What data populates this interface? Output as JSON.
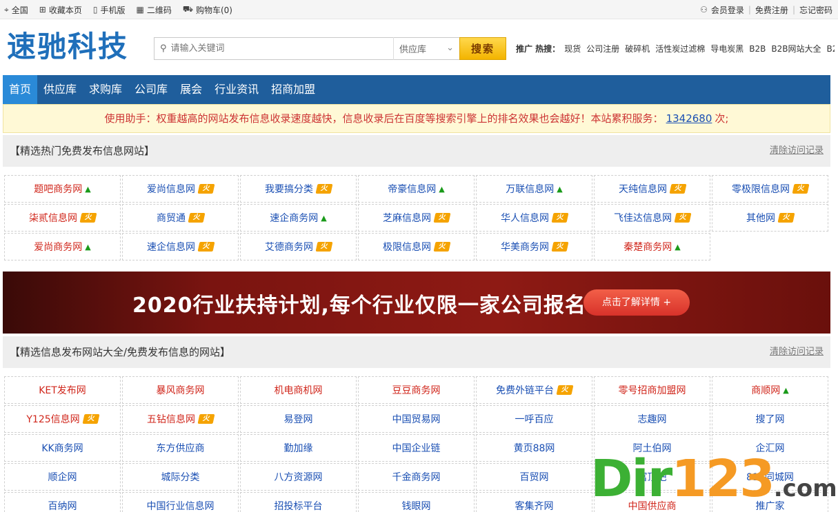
{
  "topbar": {
    "left": [
      {
        "icon": "location-icon",
        "glyph": "⌖",
        "label": "全国"
      },
      {
        "icon": "bookmark-icon",
        "glyph": "⊞",
        "label": "收藏本页"
      },
      {
        "icon": "mobile-icon",
        "glyph": "▯",
        "label": "手机版"
      },
      {
        "icon": "qrcode-icon",
        "glyph": "▦",
        "label": "二维码"
      },
      {
        "icon": "cart-icon",
        "glyph": "⛟",
        "label": "购物车(0)"
      }
    ],
    "login": "会员登录",
    "register": "免费注册",
    "forgot": "忘记密码"
  },
  "logo": "速驰科技",
  "search": {
    "placeholder": "请输入关键词",
    "category": "供应库",
    "button": "搜索"
  },
  "hot": {
    "label": "推广 热搜：",
    "words": [
      "现货",
      "公司注册",
      "破碎机",
      "活性炭过滤棉",
      "导电炭黑",
      "B2B",
      "B2B网站大全",
      "B2"
    ]
  },
  "nav": [
    "首页",
    "供应库",
    "求购库",
    "公司库",
    "展会",
    "行业资讯",
    "招商加盟"
  ],
  "notice": {
    "text_before": "使用助手：权重越高的网站发布信息收录速度越快，信息收录后在百度等搜索引擎上的排名效果也会越好！本站累积服务：",
    "count": "1342680",
    "text_after": "次;"
  },
  "section1": {
    "title": "【精选热门免费发布信息网站】",
    "clear": "清除访问记录",
    "items": [
      {
        "label": "题吧商务网",
        "color": "red",
        "badge": "up"
      },
      {
        "label": "爱尚信息网",
        "color": "blue",
        "badge": "hot"
      },
      {
        "label": "我要搞分类",
        "color": "blue",
        "badge": "hot"
      },
      {
        "label": "帝豪信息网",
        "color": "blue",
        "badge": "up"
      },
      {
        "label": "万联信息网",
        "color": "blue",
        "badge": "up"
      },
      {
        "label": "天纯信息网",
        "color": "blue",
        "badge": "hot"
      },
      {
        "label": "零极限信息网",
        "color": "blue",
        "badge": "hot"
      },
      {
        "label": "柒贰信息网",
        "color": "red",
        "badge": "hot"
      },
      {
        "label": "商贸通",
        "color": "blue",
        "badge": "hot"
      },
      {
        "label": "速企商务网",
        "color": "blue",
        "badge": "up"
      },
      {
        "label": "芝麻信息网",
        "color": "blue",
        "badge": "hot"
      },
      {
        "label": "华人信息网",
        "color": "blue",
        "badge": "hot"
      },
      {
        "label": "飞佳达信息网",
        "color": "blue",
        "badge": "hot"
      },
      {
        "label": "其他网",
        "color": "blue",
        "badge": "hot"
      },
      {
        "label": "爱尚商务网",
        "color": "red",
        "badge": "up"
      },
      {
        "label": "速企信息网",
        "color": "blue",
        "badge": "hot"
      },
      {
        "label": "艾德商务网",
        "color": "blue",
        "badge": "hot"
      },
      {
        "label": "极限信息网",
        "color": "blue",
        "badge": "hot"
      },
      {
        "label": "华美商务网",
        "color": "blue",
        "badge": "hot"
      },
      {
        "label": "秦楚商务网",
        "color": "red",
        "badge": "up"
      }
    ]
  },
  "banner": {
    "text": "2020行业扶持计划,每个行业仅限一家公司报名",
    "cta": "点击了解详情 +"
  },
  "section2": {
    "title": "【精选信息发布网站大全/免费发布信息的网站】",
    "clear": "清除访问记录",
    "items": [
      {
        "label": "KET发布网",
        "color": "red",
        "badge": ""
      },
      {
        "label": "暴风商务网",
        "color": "red",
        "badge": ""
      },
      {
        "label": "机电商机网",
        "color": "red",
        "badge": ""
      },
      {
        "label": "豆豆商务网",
        "color": "red",
        "badge": ""
      },
      {
        "label": "免费外链平台",
        "color": "blue",
        "badge": "hot"
      },
      {
        "label": "零号招商加盟网",
        "color": "red",
        "badge": ""
      },
      {
        "label": "商顺网",
        "color": "red",
        "badge": "up"
      },
      {
        "label": "Y125信息网",
        "color": "red",
        "badge": "hot"
      },
      {
        "label": "五钻信息网",
        "color": "red",
        "badge": "hot"
      },
      {
        "label": "易登网",
        "color": "blue",
        "badge": ""
      },
      {
        "label": "中国贸易网",
        "color": "blue",
        "badge": ""
      },
      {
        "label": "一呼百应",
        "color": "blue",
        "badge": ""
      },
      {
        "label": "志趣网",
        "color": "blue",
        "badge": ""
      },
      {
        "label": "搜了网",
        "color": "blue",
        "badge": ""
      },
      {
        "label": "KK商务网",
        "color": "blue",
        "badge": ""
      },
      {
        "label": "东方供应商",
        "color": "blue",
        "badge": ""
      },
      {
        "label": "勤加缘",
        "color": "blue",
        "badge": ""
      },
      {
        "label": "中国企业链",
        "color": "blue",
        "badge": ""
      },
      {
        "label": "黄页88网",
        "color": "blue",
        "badge": ""
      },
      {
        "label": "阿土伯网",
        "color": "blue",
        "badge": ""
      },
      {
        "label": "企汇网",
        "color": "blue",
        "badge": ""
      },
      {
        "label": "顺企网",
        "color": "blue",
        "badge": ""
      },
      {
        "label": "城际分类",
        "color": "blue",
        "badge": ""
      },
      {
        "label": "八方资源网",
        "color": "blue",
        "badge": ""
      },
      {
        "label": "千金商务网",
        "color": "blue",
        "badge": ""
      },
      {
        "label": "百贸网",
        "color": "blue",
        "badge": ""
      },
      {
        "label": "富顶吧",
        "color": "blue",
        "badge": ""
      },
      {
        "label": "818同城网",
        "color": "blue",
        "badge": ""
      },
      {
        "label": "百纳网",
        "color": "blue",
        "badge": ""
      },
      {
        "label": "中国行业信息网",
        "color": "blue",
        "badge": ""
      },
      {
        "label": "招投标平台",
        "color": "blue",
        "badge": ""
      },
      {
        "label": "钱眼网",
        "color": "blue",
        "badge": ""
      },
      {
        "label": "客集齐网",
        "color": "blue",
        "badge": ""
      },
      {
        "label": "中国供应商",
        "color": "red",
        "badge": ""
      },
      {
        "label": "推广家",
        "color": "blue",
        "badge": ""
      }
    ]
  },
  "watermark": {
    "part1": "Dir",
    "part2": "123",
    "part3": ".com"
  },
  "colors": {
    "nav": "#1f5e9c",
    "nav_active": "#2a8ad8",
    "logo": "#1f6fba",
    "red": "#d0261b",
    "blue": "#1a4fb3"
  }
}
